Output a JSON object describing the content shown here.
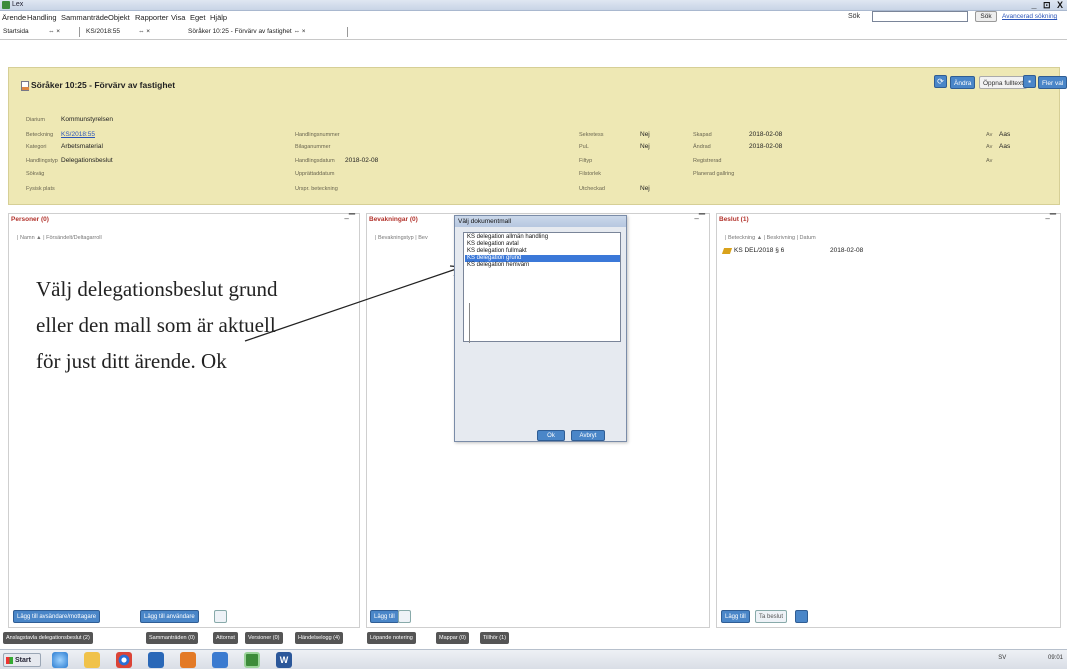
{
  "window": {
    "title": "Lex",
    "controls": "_ ⊡ X"
  },
  "menu": {
    "items": [
      "Ärende",
      "Handling",
      "Sammanträde",
      "Objekt",
      "Rapporter",
      "Visa",
      "Eget",
      "Hjälp"
    ],
    "search_label": "Sök",
    "search_value": "",
    "search_button": "Sök",
    "advanced_link": "Avancerad sökning"
  },
  "tabs": [
    {
      "label": "Startsida"
    },
    {
      "label": "⇔ ×"
    },
    {
      "label": "KS/2018:55"
    },
    {
      "label": "⇔ ×"
    },
    {
      "label": "Söråker 10:25 - Förvärv av fastighet ⇔ ×"
    }
  ],
  "header": {
    "title": "Söråker 10:25 - Förvärv av fastighet",
    "buttons": {
      "andra": "Ändra",
      "oppna": "Öppna fulltext",
      "flerval": "Fler val"
    },
    "fields": {
      "diarium_label": "Diarium",
      "diarium_value": "Kommunstyrelsen",
      "beteckning_label": "Beteckning",
      "beteckning_value": "KS/2018:55",
      "kategori_label": "Kategori",
      "kategori_value": "Arbetsmaterial",
      "handlingstyp_label": "Handlingstyp",
      "handlingstyp_value": "Delegationsbeslut",
      "sokvag_label": "Sökväg",
      "fysisk_label": "Fysisk plats",
      "handlingsnummer_label": "Handlingsnummer",
      "bilaganummer_label": "Bilaganummer",
      "handlingsdatum_label": "Handlingsdatum",
      "handlingsdatum_value": "2018-02-08",
      "upprattad_label": "Upprättaddatum",
      "ursp_label": "Urspr. beteckning",
      "sekretess_label": "Sekretess",
      "sekretess_value": "Nej",
      "pul_label": "PuL",
      "pul_value": "Nej",
      "filtyp_label": "Filtyp",
      "filstorlek_label": "Filstorlek",
      "utcheckad_label": "Utcheckad",
      "utcheckad_value": "Nej",
      "skapad_label": "Skapad",
      "skapad_value": "2018-02-08",
      "andrad_label": "Ändrad",
      "andrad_value": "2018-02-08",
      "registrerad_label": "Registrerad",
      "planerad_label": "Planerad gallring",
      "av1_label": "Av",
      "av1_value": "Aas",
      "av2_label": "Av",
      "av2_value": "Aas",
      "av3_label": "Av"
    }
  },
  "panels": {
    "personer": {
      "title": "Personer (0)",
      "columns": "| Namn ▲ |  Försändelt/Deltagarroll",
      "btn_add_recipient": "Lägg till avsändare/mottagare",
      "btn_add_user": "Lägg till användare"
    },
    "bevakningar": {
      "title": "Bevakningar (0)",
      "columns": "| Bevakningstyp | Bev",
      "btn_add": "Lägg till"
    },
    "beslut": {
      "title": "Beslut (1)",
      "columns": "| Beteckning ▲  | Beskrivning | Datum",
      "row_id": "KS DEL/2018 § 6",
      "row_date": "2018-02-08",
      "btn_add": "Lägg till",
      "btn_take": "Ta beslut"
    }
  },
  "dialog": {
    "title": "Välj dokumentmall",
    "items": [
      "KS delegation allmän handling",
      "KS delegation avtal",
      "KS delegation fullmakt",
      "KS delegation grund",
      "KS delegation hemvärn"
    ],
    "selected_index": 3,
    "ok": "Ok",
    "cancel": "Avbryt"
  },
  "annotation": {
    "lines": [
      "Välj delegationsbeslut grund",
      "eller den mall som är aktuell",
      "för just ditt ärende. Ok"
    ]
  },
  "bottom_tabs": [
    "Anslagstavla delegationsbeslut (2)",
    "Sammanträden (0)",
    "Attornst",
    "Versioner (0)",
    "Händelselogg (4)",
    "Löpande notering",
    "Mappar (0)",
    "Tillhör (1)"
  ],
  "taskbar": {
    "start": "Start",
    "lang": "SV",
    "time": "09:01"
  },
  "colors": {
    "header_bg": "#eee8b4",
    "accent": "#4a86c8",
    "panel_title": "#b2332c",
    "selection": "#3b78d8"
  }
}
